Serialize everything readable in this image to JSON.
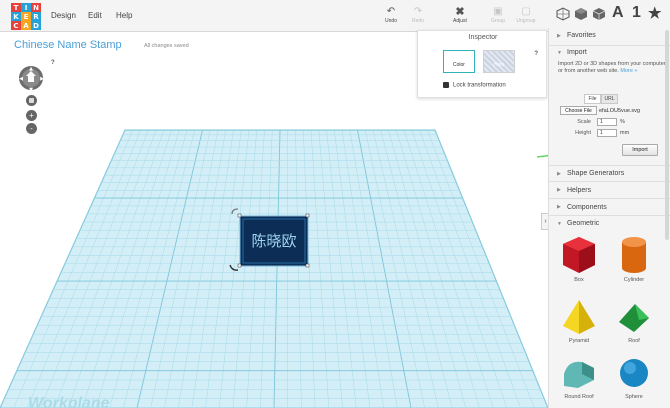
{
  "logo": {
    "letters": [
      "T",
      "I",
      "N",
      "K",
      "E",
      "R",
      "C",
      "A",
      "D"
    ]
  },
  "menu": [
    "Design",
    "Edit",
    "Help"
  ],
  "toolbar": {
    "undo": "Undo",
    "redo": "Redo",
    "adjust": "Adjust",
    "group": "Group",
    "ungroup": "Ungroup",
    "letter_icon": "A",
    "number_icon": "1"
  },
  "project": {
    "title": "Chinese Name Stamp",
    "status": "All changes saved"
  },
  "nav": {
    "help": "?",
    "zoom_in": "+",
    "zoom_out": "-"
  },
  "inspector": {
    "title": "Inspector",
    "color_label": "Color",
    "hole_label": "Hole",
    "help": "?",
    "lock_label": "Lock transformation"
  },
  "workplane": {
    "label": "Workplane"
  },
  "stamp": {
    "chars": "陈晓欧"
  },
  "sidebar": {
    "favorites": "Favorites",
    "import": {
      "title": "Import",
      "desc": "Import 2D or 3D shapes from your computer or from another web site.",
      "more": "More »",
      "tab_file": "File",
      "tab_url": "URL",
      "choose_file": "Choose File",
      "file_name": "efaLOU5vue.svg",
      "scale_label": "Scale",
      "scale_value": "1",
      "scale_unit": "%",
      "height_label": "Height",
      "height_value": "1",
      "height_unit": "mm",
      "import_button": "Import"
    },
    "shape_generators": "Shape Generators",
    "helpers": "Helpers",
    "components": "Components",
    "geometric": "Geometric",
    "shapes": [
      "Box",
      "Cylinder",
      "Pyramid",
      "Roof",
      "Round Roof",
      "Sphere"
    ]
  },
  "colors": {
    "accent": "#4a9fd8",
    "grid_line": "#8ecfe0",
    "grid_fill": "#d3eef6",
    "arrow": "#5fd45f"
  }
}
